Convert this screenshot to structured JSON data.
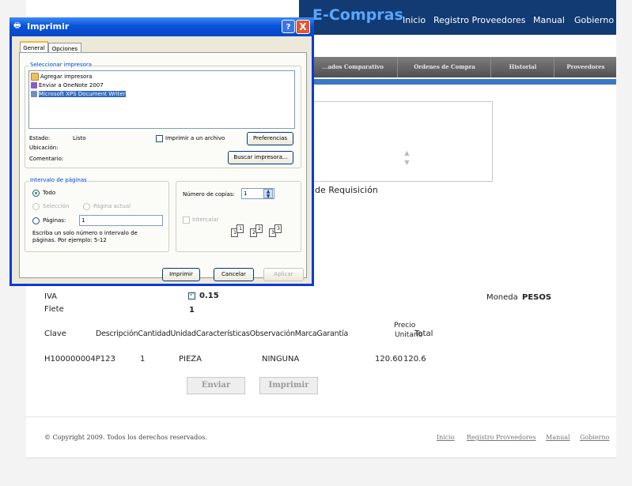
{
  "header": {
    "brand": "E-Compras",
    "nav": [
      "Inicio",
      "Registro Proveedores",
      "Manual",
      "Gobierno"
    ]
  },
  "tabs": [
    "...ados Comparativo",
    "Ordenes de Compra",
    "Historial",
    "Proveedores"
  ],
  "form": {
    "requisicion_label": "de Requisición",
    "iva_label": "IVA",
    "iva_value": "0.15",
    "iva_checked": true,
    "flete_label": "Flete",
    "flete_value": "1",
    "moneda_label": "Moneda",
    "moneda_value": "PESOS"
  },
  "table": {
    "headers": [
      "Clave",
      "DescripciónCantidadUnidadCaracterísticasObservaciónMarcaGarantía",
      "Precio",
      "Unitario",
      "Total"
    ],
    "rows": [
      {
        "clave": "H100000004P123",
        "cantidad": "1",
        "unidad": "PIEZA",
        "caracteristicas": "NINGUNA",
        "precio": "120.60",
        "total": "120.6"
      }
    ]
  },
  "buttons": {
    "enviar": "Enviar",
    "imprimir": "Imprimir"
  },
  "footer": {
    "copyright": "© Copyright 2009. Todos los derechos reservados.",
    "links": [
      "Inicio",
      "Registro Proveedores",
      "Manual",
      "Gobierno"
    ]
  },
  "dialog": {
    "title": "Imprimir",
    "help": "?",
    "close": "X",
    "tabs": [
      "General",
      "Opciones"
    ],
    "select_printer_label": "Seleccionar impresora",
    "printers": [
      "Agregar impresora",
      "Enviar a OneNote 2007",
      "Microsoft XPS Document Writer"
    ],
    "estado_label": "Estado:",
    "estado_value": "Listo",
    "ubicacion_label": "Ubicación:",
    "comentario_label": "Comentario:",
    "print_to_file": "Imprimir a un archivo",
    "preferencias": "Preferencias",
    "buscar": "Buscar impresora...",
    "range_label": "Intervalo de páginas",
    "todo": "Todo",
    "seleccion": "Selección",
    "pagina_actual": "Página actual",
    "paginas": "Páginas:",
    "paginas_value": "1",
    "hint": "Escriba un solo número o intervalo de páginas. Por ejemplo: 5-12",
    "copias_label": "Número de copias:",
    "copias_value": "1",
    "intercalar": "Intercalar",
    "collate_pages": [
      "1",
      "1",
      "2",
      "2",
      "3",
      "3"
    ],
    "imprimir_btn": "Imprimir",
    "cancelar_btn": "Cancelar",
    "aplicar_btn": "Aplicar"
  }
}
